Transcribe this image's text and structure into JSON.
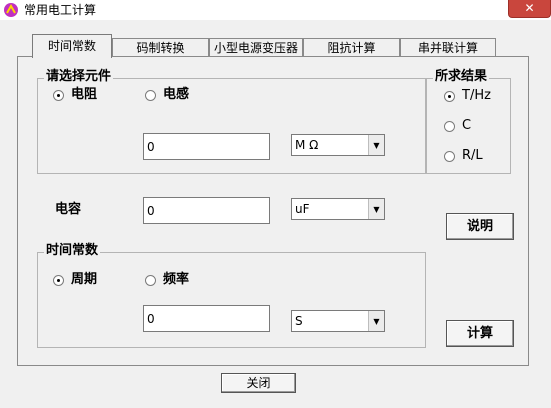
{
  "window": {
    "title": "常用电工计算",
    "close_glyph": "✕"
  },
  "tabs": [
    {
      "label": "时间常数",
      "active": true
    },
    {
      "label": "码制转换",
      "active": false
    },
    {
      "label": "小型电源变压器",
      "active": false
    },
    {
      "label": "阻抗计算",
      "active": false
    },
    {
      "label": "串并联计算",
      "active": false
    }
  ],
  "component_group": {
    "legend": "请选择元件",
    "radios": [
      {
        "label": "电阻",
        "checked": true
      },
      {
        "label": "电感",
        "checked": false
      }
    ],
    "value": "0",
    "unit": "M Ω"
  },
  "result_group": {
    "legend": "所求结果",
    "radios": [
      {
        "label": "T/Hz",
        "checked": true
      },
      {
        "label": "C",
        "checked": false
      },
      {
        "label": "R/L",
        "checked": false
      }
    ]
  },
  "capacitance": {
    "label": "电容",
    "value": "0",
    "unit": "uF"
  },
  "time_constant_group": {
    "legend": "时间常数",
    "radios": [
      {
        "label": "周期",
        "checked": true
      },
      {
        "label": "频率",
        "checked": false
      }
    ],
    "value": "0",
    "unit": "S"
  },
  "buttons": {
    "explain": "说明",
    "calculate": "计算",
    "close": "关闭"
  },
  "colors": {
    "close_button": "#c9463d",
    "background": "#f0f0f0"
  },
  "icons": {
    "app": "app-logo-icon",
    "dropdown": "chevron-down-icon"
  }
}
